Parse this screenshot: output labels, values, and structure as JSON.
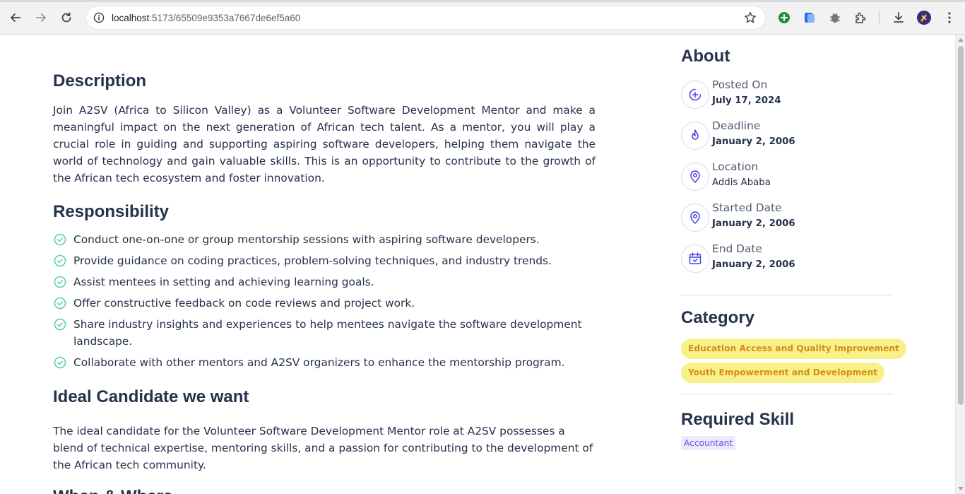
{
  "browser": {
    "url_host": "localhost",
    "url_path": ":5173/65509e9353a7667de6ef5a60"
  },
  "description": {
    "title": "Description",
    "text": "Join A2SV (Africa to Silicon Valley) as a Volunteer Software Development Mentor and make a meaningful impact on the next generation of African tech talent. As a mentor, you will play a crucial role in guiding and supporting aspiring software developers, helping them navigate the world of technology and gain valuable skills. This is an opportunity to contribute to the growth of the African tech ecosystem and foster innovation."
  },
  "responsibility": {
    "title": "Responsibility",
    "items": [
      "Conduct one-on-one or group mentorship sessions with aspiring software developers.",
      "Provide guidance on coding practices, problem-solving techniques, and industry trends.",
      "Assist mentees in setting and achieving learning goals.",
      "Offer constructive feedback on code reviews and project work.",
      "Share industry insights and experiences to help mentees navigate the software development landscape.",
      "Collaborate with other mentors and A2SV organizers to enhance the mentorship program."
    ]
  },
  "ideal": {
    "title": "Ideal Candidate we want",
    "text": "The ideal candidate for the Volunteer Software Development Mentor role at A2SV possesses a blend of technical expertise, mentoring skills, and a passion for contributing to the development of the African tech community."
  },
  "next_section": {
    "title": "When & Where"
  },
  "about": {
    "title": "About",
    "items": [
      {
        "label": "Posted On",
        "value": "July 17, 2024",
        "icon": "plus-circle-icon"
      },
      {
        "label": "Deadline",
        "value": "January 2, 2006",
        "icon": "fire-icon"
      },
      {
        "label": "Location",
        "value": "Addis Ababa",
        "icon": "location-pin-icon"
      },
      {
        "label": "Started Date",
        "value": "January 2, 2006",
        "icon": "location-pin-icon"
      },
      {
        "label": "End Date",
        "value": "January 2, 2006",
        "icon": "calendar-icon"
      }
    ]
  },
  "category": {
    "title": "Category",
    "items": [
      "Education Access and Quality Improvement",
      "Youth Empowerment and Development"
    ]
  },
  "skills": {
    "title": "Required Skill",
    "items": [
      "Accountant"
    ]
  },
  "colors": {
    "heading": "#25324b",
    "accent_blue": "#4640de",
    "check_green": "#56cdad",
    "chip_yellow_bg": "#f8f18a",
    "chip_yellow_text": "#d98a18",
    "skill_bg": "#ecebfd",
    "skill_text": "#6b4ee0"
  }
}
